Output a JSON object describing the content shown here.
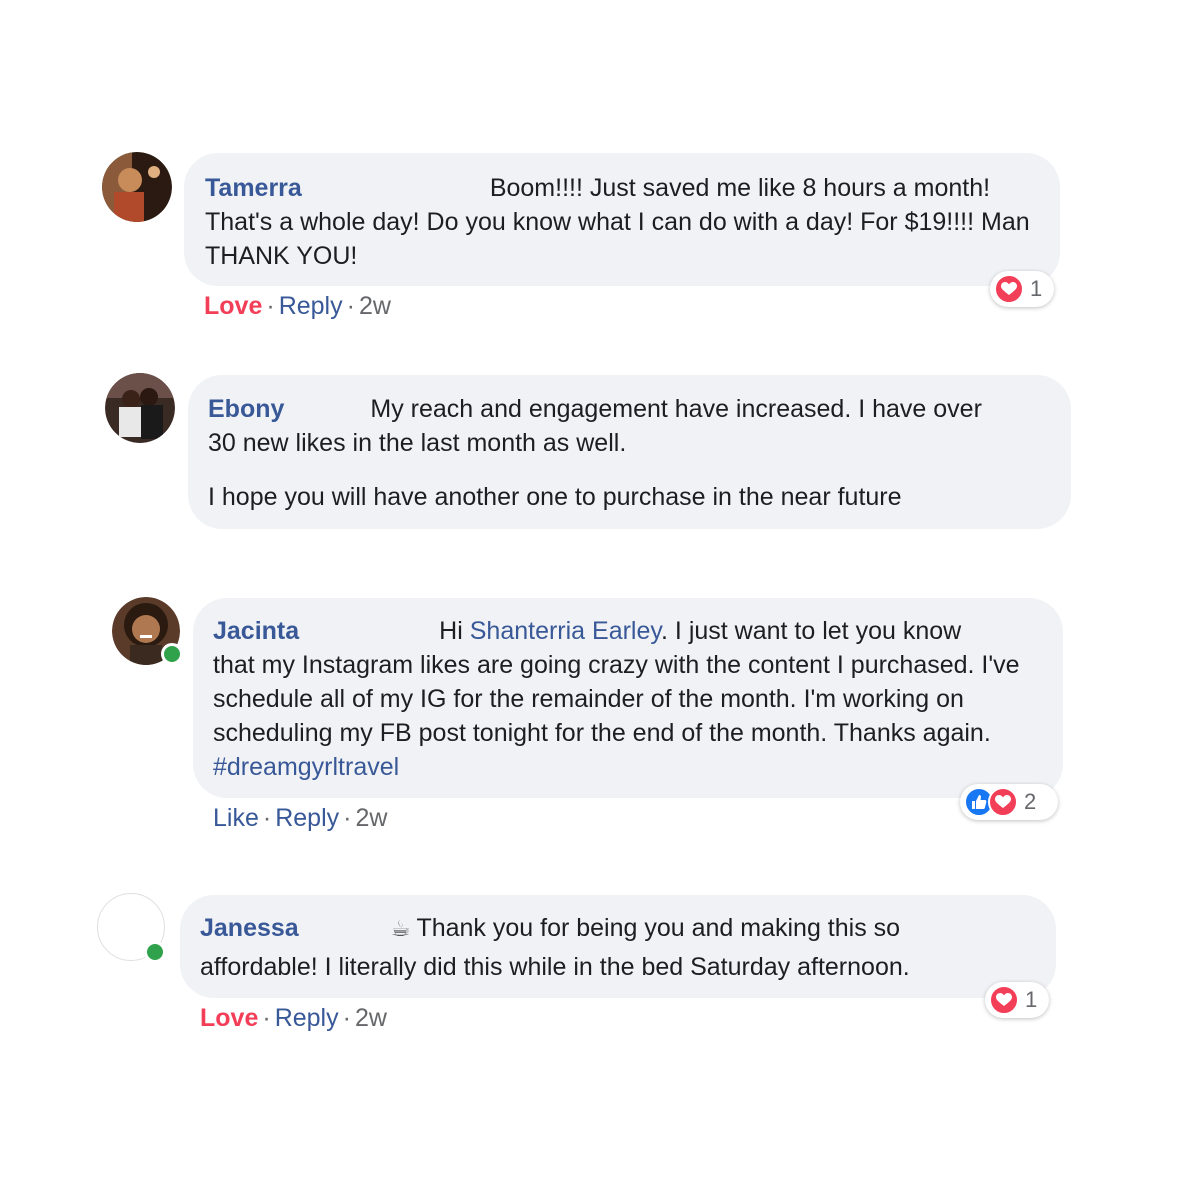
{
  "comments": [
    {
      "author": "Tamerra",
      "text_line1": "Boom!!!! Just saved me like 8 hours a month!",
      "text_rest": "That's a whole day! Do you know what I can do with a day! For $19!!!! Man THANK YOU!",
      "action_reaction": "Love",
      "reply_label": "Reply",
      "time": "2w",
      "reaction_count": "1",
      "reaction_icons": [
        "love-icon"
      ],
      "colors": {
        "avatar_bg": "#6b3a22"
      }
    },
    {
      "author": "Ebony",
      "text_line1": "My reach and engagement have increased. I have over",
      "text_rest": "30 new likes in the last month as well.",
      "text_para2": "I hope you will have another one to purchase in the near future",
      "colors": {
        "avatar_bg": "#3d2b26"
      }
    },
    {
      "author": "Jacinta",
      "text_pre": "Hi ",
      "mention": "Shanterria Earley",
      "text_line1_rest": ". I just want to let you know",
      "text_rest": "that my Instagram likes are going crazy with the content I purchased. I've schedule all of my IG for the remainder of the month. I'm working on scheduling my FB post tonight for the end of the month. Thanks again. ",
      "hashtag": "#dreamgyrltravel",
      "action_reaction": "Like",
      "reply_label": "Reply",
      "time": "2w",
      "reaction_count": "2",
      "reaction_icons": [
        "like-icon",
        "love-icon"
      ],
      "colors": {
        "avatar_bg": "#7a5238"
      }
    },
    {
      "author": "Janessa",
      "emoji": "☕",
      "text_line1": "Thank you for being you and making this so",
      "text_rest": "affordable! I literally did this while in the bed Saturday afternoon.",
      "action_reaction": "Love",
      "reply_label": "Reply",
      "time": "2w",
      "reaction_count": "1",
      "reaction_icons": [
        "love-icon"
      ]
    }
  ],
  "colors": {
    "bubble_bg": "#f0f2f5",
    "author": "#385898",
    "love": "#f33e58",
    "like": "#1877f2",
    "online": "#31a24c"
  }
}
